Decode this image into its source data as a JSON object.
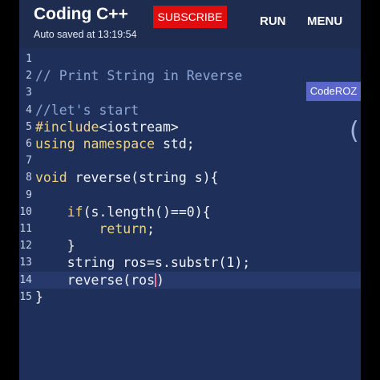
{
  "app": {
    "title": "Coding C++",
    "autosave_text": "Auto saved at 13:19:54"
  },
  "toolbar": {
    "subscribe_label": "SUBSCRIBE",
    "run_label": "RUN",
    "menu_label": "MENU"
  },
  "watermark": "CodeROZ",
  "edge_glyph": "(",
  "colors": {
    "appbar": "#1d2c4f",
    "editor_bg": "#1e2f5a",
    "subscribe_bg": "#e00d0d",
    "keyword": "#f0d27a",
    "comment": "#8ea7d6",
    "text": "#f1f4fb",
    "caret": "#f07a9a"
  },
  "editor": {
    "current_line": 14,
    "lines": [
      {
        "n": "1",
        "tokens": []
      },
      {
        "n": "2",
        "tokens": [
          {
            "t": "// Print String in Reverse",
            "c": "comment"
          }
        ]
      },
      {
        "n": "3",
        "tokens": []
      },
      {
        "n": "4",
        "tokens": [
          {
            "t": "//let's start",
            "c": "comment"
          }
        ]
      },
      {
        "n": "5",
        "tokens": [
          {
            "t": "#include",
            "c": "kw"
          },
          {
            "t": "<iostream>",
            "c": "text"
          }
        ]
      },
      {
        "n": "6",
        "tokens": [
          {
            "t": "using",
            "c": "kw"
          },
          {
            "t": " ",
            "c": "text"
          },
          {
            "t": "namespace",
            "c": "kw"
          },
          {
            "t": " std;",
            "c": "text"
          }
        ]
      },
      {
        "n": "7",
        "tokens": []
      },
      {
        "n": "8",
        "tokens": [
          {
            "t": "void",
            "c": "kw"
          },
          {
            "t": " reverse(string s){",
            "c": "text"
          }
        ]
      },
      {
        "n": "9",
        "tokens": []
      },
      {
        "n": "10",
        "tokens": [
          {
            "t": "    ",
            "c": "text"
          },
          {
            "t": "if",
            "c": "kw"
          },
          {
            "t": "(s.length()==0){",
            "c": "text"
          }
        ]
      },
      {
        "n": "11",
        "tokens": [
          {
            "t": "        ",
            "c": "text"
          },
          {
            "t": "return",
            "c": "kw"
          },
          {
            "t": ";",
            "c": "text"
          }
        ]
      },
      {
        "n": "12",
        "tokens": [
          {
            "t": "    }",
            "c": "text"
          }
        ]
      },
      {
        "n": "13",
        "tokens": [
          {
            "t": "    string ros=s.substr(1);",
            "c": "text"
          }
        ]
      },
      {
        "n": "14",
        "tokens": [
          {
            "t": "    reverse(ros",
            "c": "text"
          },
          {
            "caret": true
          },
          {
            "t": ")",
            "c": "text"
          }
        ]
      },
      {
        "n": "15",
        "tokens": [
          {
            "t": "}",
            "c": "text"
          }
        ]
      }
    ]
  }
}
